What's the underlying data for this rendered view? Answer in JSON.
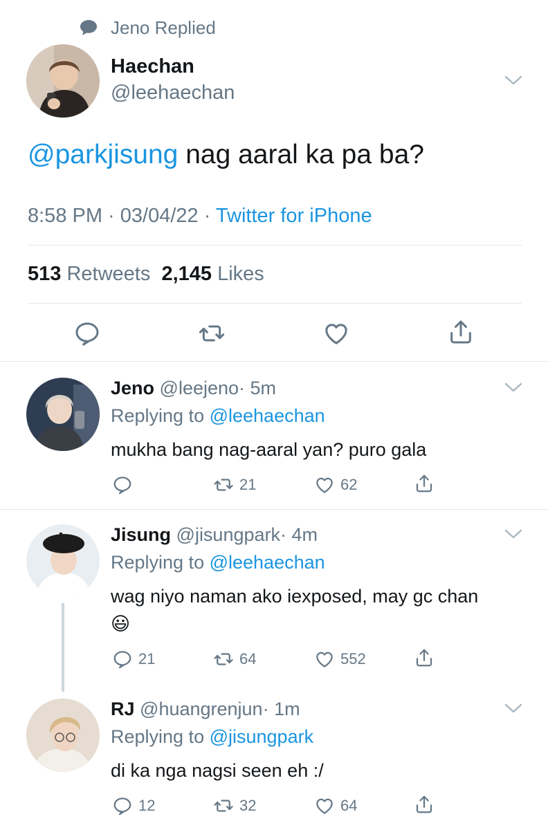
{
  "context": {
    "icon": "speech-bubble-icon",
    "text": "Jeno Replied"
  },
  "main_tweet": {
    "name": "Haechan",
    "handle": "@leehaechan",
    "mention": "@parkjisung",
    "text": " nag aaral ka pa ba?",
    "time": "8:58 PM",
    "dot1": " · ",
    "date": "03/04/22",
    "dot2": " · ",
    "source": "Twitter for iPhone",
    "retweets": "513",
    "retweets_label": " Retweets",
    "likes": "2,145",
    "likes_label": " Likes"
  },
  "replies": [
    {
      "name": "Jeno",
      "handle": "@leejeno",
      "time": "· 5m",
      "replying_prefix": "Replying to ",
      "replying_to": "@leehaechan",
      "text": "mukha bang nag-aaral yan? puro gala",
      "reply_count": "",
      "retweet_count": "21",
      "like_count": "62"
    },
    {
      "name": "Jisung",
      "handle": "@jisungpark",
      "time": "· 4m",
      "replying_prefix": "Replying to ",
      "replying_to": "@leehaechan",
      "text": "wag niyo naman ako iexposed, may gc chan",
      "emoji": "😃",
      "reply_count": "21",
      "retweet_count": "64",
      "like_count": "552"
    },
    {
      "name": "RJ",
      "handle": "@huangrenjun",
      "time": "· 1m",
      "replying_prefix": "Replying to ",
      "replying_to": "@jisungpark",
      "text": "di ka nga nagsi seen eh :/",
      "reply_count": "12",
      "retweet_count": "32",
      "like_count": "64"
    }
  ],
  "colors": {
    "link": "#1b95e0",
    "secondary": "#657786",
    "divider": "#e1e8ed",
    "text": "#14171a"
  }
}
